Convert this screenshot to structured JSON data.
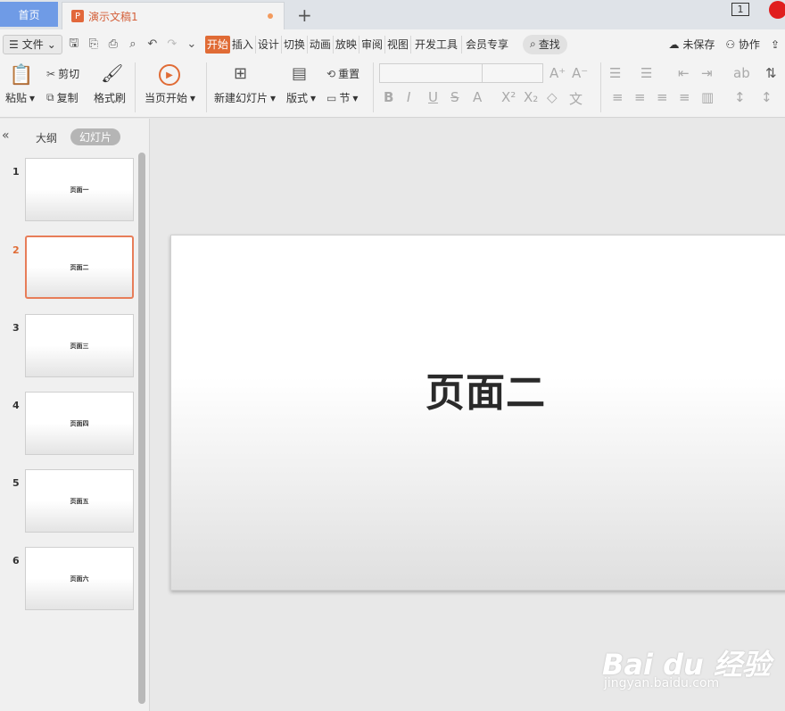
{
  "titlebar": {
    "home_tab": "首页",
    "doc_tab": "演示文稿1",
    "doc_icon": "P",
    "plus": "+",
    "window_count": "1"
  },
  "menubar": {
    "file": "文件",
    "items": [
      "开始",
      "插入",
      "设计",
      "切换",
      "动画",
      "放映",
      "审阅",
      "视图",
      "开发工具",
      "会员专享"
    ],
    "search": "查找",
    "unsaved": "未保存",
    "collab": "协作"
  },
  "ribbon": {
    "paste": "粘贴",
    "cut": "剪切",
    "copy": "复制",
    "format_painter": "格式刷",
    "play_current": "当页开始",
    "new_slide": "新建幻灯片",
    "layout": "版式",
    "reset": "重置",
    "section": "节"
  },
  "sidebar": {
    "outline_tab": "大纲",
    "slides_tab": "幻灯片",
    "slides": [
      {
        "num": "1",
        "title": "页面一"
      },
      {
        "num": "2",
        "title": "页面二"
      },
      {
        "num": "3",
        "title": "页面三"
      },
      {
        "num": "4",
        "title": "页面四"
      },
      {
        "num": "5",
        "title": "页面五"
      },
      {
        "num": "6",
        "title": "页面六"
      }
    ]
  },
  "editor": {
    "slide_title": "页面二"
  },
  "watermark": {
    "main": "Bai du 经验",
    "sub": "jingyan.baidu.com"
  }
}
